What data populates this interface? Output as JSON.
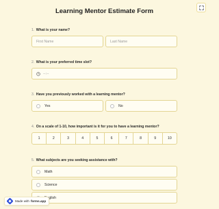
{
  "form": {
    "title": "Learning Mentor Estimate Form"
  },
  "header": {
    "fullscreen_icon": "expand-icon"
  },
  "questions": [
    {
      "number": "1.",
      "text": "What is your name?",
      "first_placeholder": "First Name",
      "last_placeholder": "Last Name"
    },
    {
      "number": "2.",
      "text": "What is your preferred time slot?",
      "time_placeholder": "--:--",
      "icon": "clock-icon"
    },
    {
      "number": "3.",
      "text": "Have you previously worked with a learning mentor?",
      "options": [
        "Yes",
        "No"
      ]
    },
    {
      "number": "4.",
      "text": "On a scale of 1-10, how important is it for you to have a learning mentor?",
      "scale": [
        "1",
        "2",
        "3",
        "4",
        "5",
        "6",
        "7",
        "8",
        "9",
        "10"
      ]
    },
    {
      "number": "5.",
      "text": "What subjects are you seeking assistance with?",
      "options": [
        "Math",
        "Science",
        "English"
      ]
    }
  ],
  "badge": {
    "prefix": "Made with",
    "brand": "forms.app",
    "icon": "forms-app-logo-icon"
  },
  "colors": {
    "background": "#fcf7df",
    "field_border": "#e3d593",
    "field_background": "#fffdf2",
    "badge_logo": "#2f4fd8"
  }
}
